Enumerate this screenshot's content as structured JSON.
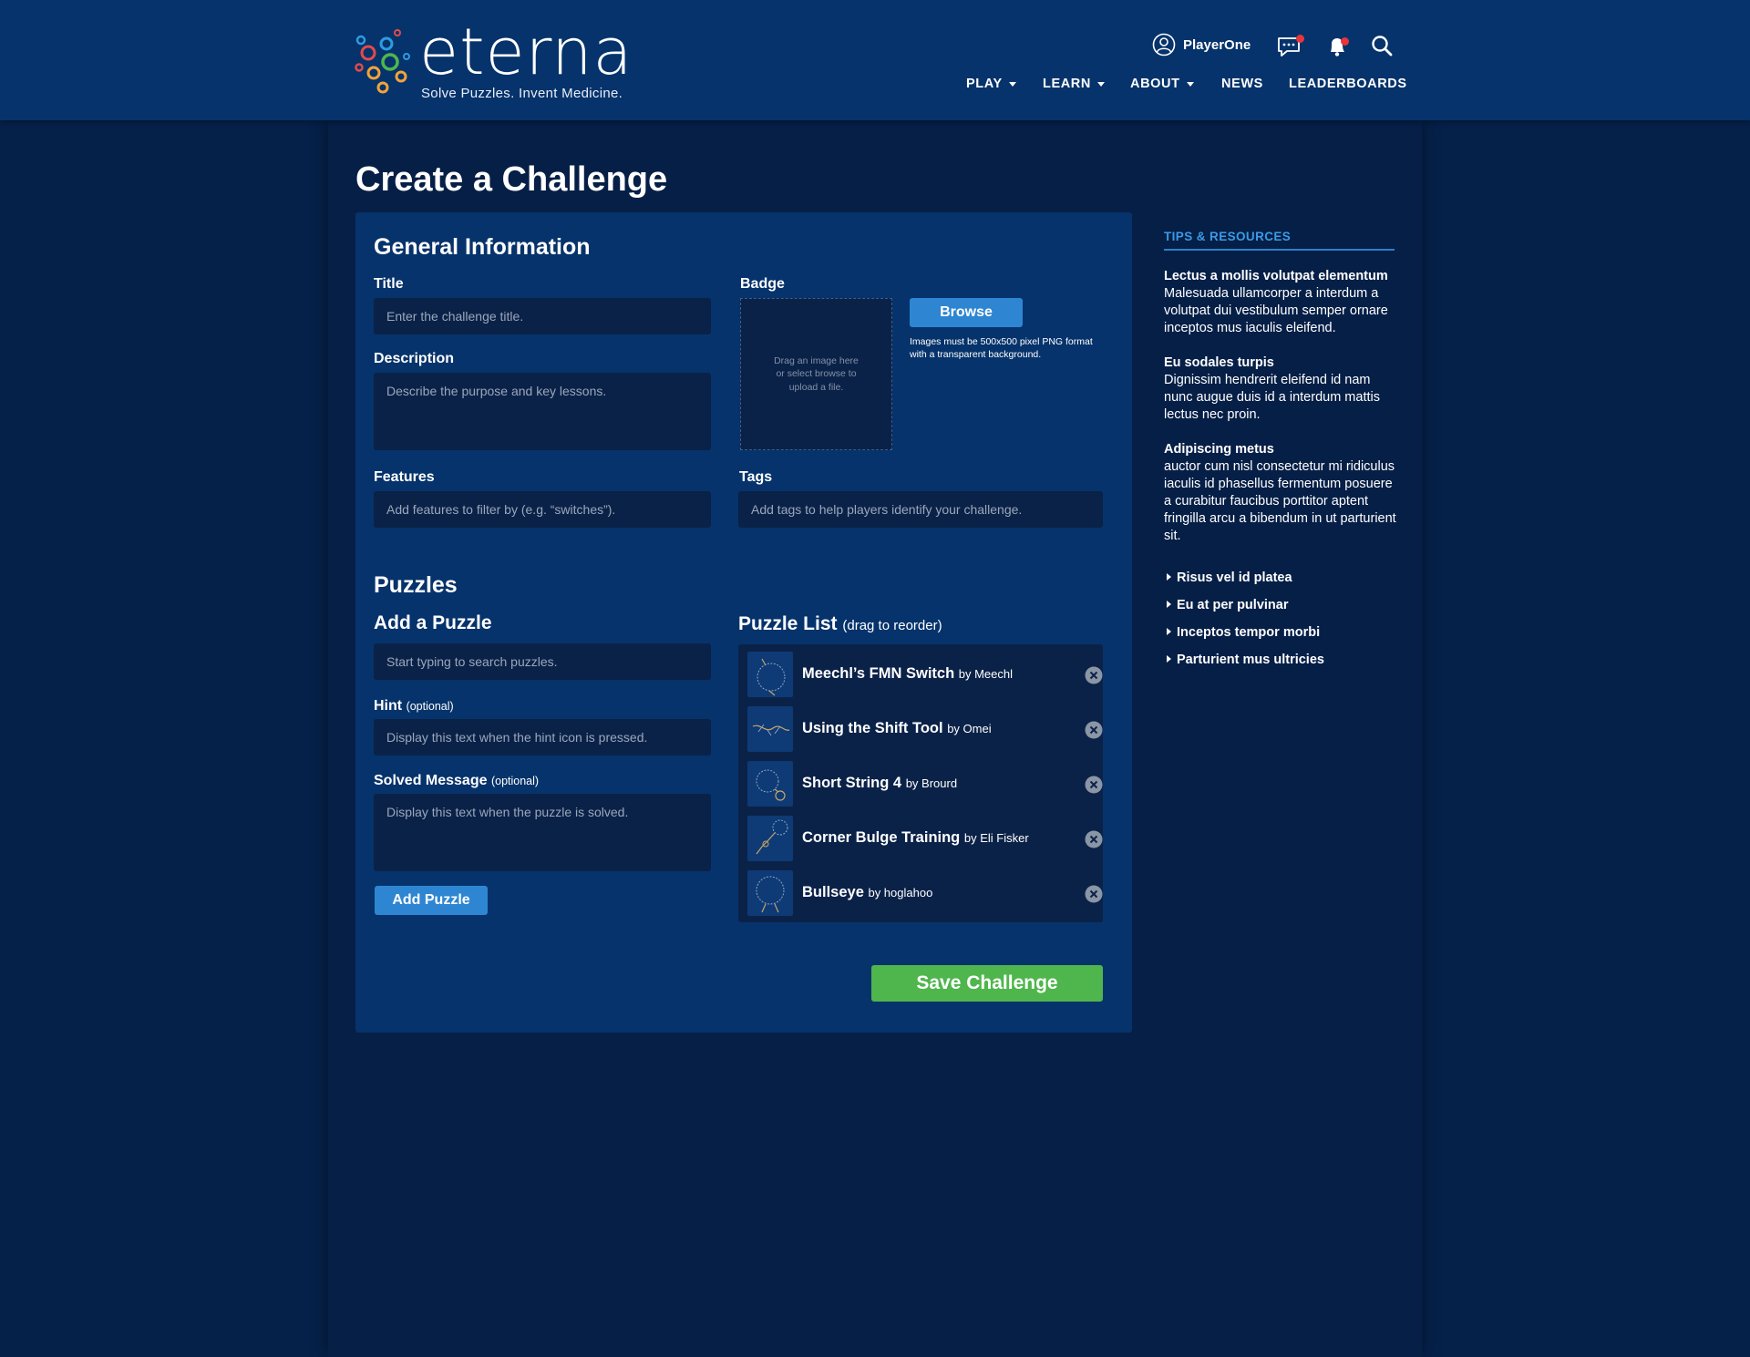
{
  "header": {
    "logo": {
      "wordmark": "eterna",
      "tagline": "Solve Puzzles. Invent Medicine."
    },
    "user": {
      "name": "PlayerOne",
      "icon": "user-icon"
    },
    "icons": [
      "chat-icon",
      "bell-icon",
      "search-icon"
    ],
    "nav": [
      "PLAY",
      "LEARN",
      "ABOUT",
      "NEWS",
      "LEADERBOARDS"
    ]
  },
  "page": {
    "title": "Create a Challenge"
  },
  "general": {
    "heading": "General Information",
    "title_label": "Title",
    "title_placeholder": "Enter the challenge title.",
    "description_label": "Description",
    "description_placeholder": "Describe the purpose and key lessons.",
    "features_label": "Features",
    "features_placeholder": "Add features to filter by (e.g. “switches”).",
    "badge_label": "Badge",
    "badge_drop_text": "Drag an image here or select browse to upload a file.",
    "browse_label": "Browse",
    "badge_note": "Images must be 500x500 pixel PNG format with a transparent background.",
    "tags_label": "Tags",
    "tags_placeholder": "Add tags to help players identify your challenge."
  },
  "puzzles": {
    "heading": "Puzzles",
    "add_heading": "Add a Puzzle",
    "search_placeholder": "Start typing to search puzzles.",
    "hint_label": "Hint",
    "hint_optional": "(optional)",
    "hint_placeholder": "Display this text when the hint icon is pressed.",
    "solved_label": "Solved Message",
    "solved_optional": "(optional)",
    "solved_placeholder": "Display this text when the puzzle is solved.",
    "add_button": "Add Puzzle",
    "list_heading": "Puzzle List",
    "list_note": "(drag to reorder)",
    "items": [
      {
        "name": "Meechl’s FMN Switch",
        "by": "by Meechl"
      },
      {
        "name": "Using the Shift Tool",
        "by": "by Omei"
      },
      {
        "name": "Short String 4",
        "by": "by Brourd"
      },
      {
        "name": "Corner Bulge Training",
        "by": "by Eli Fisker"
      },
      {
        "name": "Bullseye",
        "by": "by hoglahoo"
      }
    ]
  },
  "save_label": "Save Challenge",
  "sidebar": {
    "title": "TIPS & RESOURCES",
    "tips": [
      {
        "title": "Lectus a mollis volutpat elementum",
        "body": "Malesuada ullamcorper a interdum a volutpat dui vestibulum semper ornare inceptos mus iaculis eleifend."
      },
      {
        "title": "Eu sodales turpis",
        "body": "Dignissim hendrerit eleifend id nam nunc augue duis id a interdum mattis lectus nec proin."
      },
      {
        "title": "Adipiscing metus",
        "body": "auctor cum nisl consectetur mi ridiculus iaculis id phasellus fermentum posuere a curabitur faucibus porttitor aptent fringilla arcu a bibendum in ut parturient sit."
      }
    ],
    "links": [
      "Risus vel id platea",
      "Eu at per pulvinar",
      "Inceptos tempor morbi",
      "Parturient mus ultricies"
    ]
  },
  "colors": {
    "header_bg": "#06336b",
    "page_bg": "#05214a",
    "panel_bg": "#06336b",
    "input_bg": "#0b2248",
    "accent_blue": "#2e86d2",
    "save_green": "#4fb64d",
    "sidebar_title": "#3a9be6",
    "notification_dot": "#e8353b"
  }
}
